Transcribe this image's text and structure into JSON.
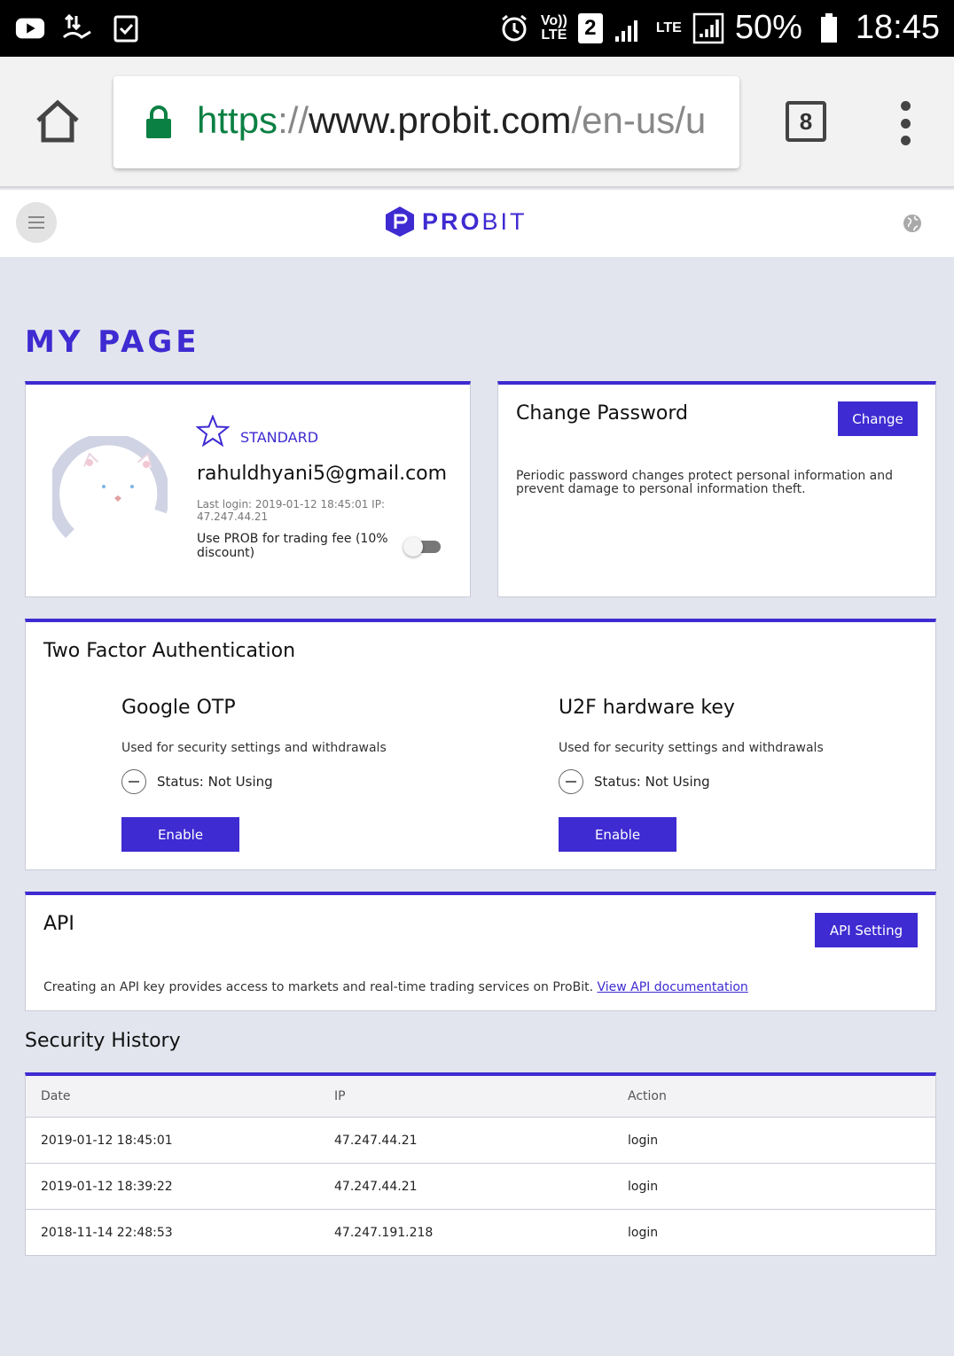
{
  "status_bar": {
    "battery": "50%",
    "time": "18:45",
    "volte_label": "Vo))",
    "lte_label": "LTE",
    "sim_number": "2",
    "signal_lte": "LTE"
  },
  "browser": {
    "url_scheme": "https",
    "url_sep": "://",
    "url_host": "www.probit.com",
    "url_path": "/en-us/u",
    "tab_count": "8"
  },
  "site": {
    "logo_pro": "PRO",
    "logo_bit": "BIT"
  },
  "page": {
    "title": "MY PAGE"
  },
  "profile": {
    "level": "STANDARD",
    "email": "rahuldhyani5@gmail.com",
    "last_login": "Last login: 2019-01-12 18:45:01 IP: 47.247.44.21",
    "prob_fee": "Use PROB for trading fee (10% discount)",
    "prob_toggle_on": false
  },
  "change_password": {
    "title": "Change Password",
    "button": "Change",
    "description": "Periodic password changes protect personal information and prevent damage to personal information theft."
  },
  "two_factor": {
    "title": "Two Factor Authentication",
    "items": [
      {
        "title": "Google OTP",
        "description": "Used for security settings and withdrawals",
        "status": "Status: Not Using",
        "button": "Enable"
      },
      {
        "title": "U2F hardware key",
        "description": "Used for security settings and withdrawals",
        "status": "Status: Not Using",
        "button": "Enable"
      }
    ]
  },
  "api": {
    "title": "API",
    "button": "API Setting",
    "description": "Creating an API key provides access to markets and real-time trading services on ProBit. ",
    "link": "View API documentation"
  },
  "security_history": {
    "title": "Security History",
    "columns": [
      "Date",
      "IP",
      "Action"
    ],
    "rows": [
      [
        "2019-01-12 18:45:01",
        "47.247.44.21",
        "login"
      ],
      [
        "2019-01-12 18:39:22",
        "47.247.44.21",
        "login"
      ],
      [
        "2018-11-14 22:48:53",
        "47.247.191.218",
        "login"
      ]
    ]
  },
  "colors": {
    "brand": "#3e2bd1",
    "page_bg": "#e3e5ee",
    "secure_green": "#0b8043"
  }
}
